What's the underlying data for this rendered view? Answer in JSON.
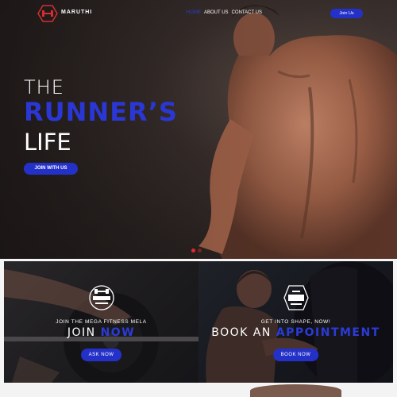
{
  "nav": {
    "brand": "MARUTHI",
    "items": [
      {
        "label": "HOME",
        "active": true
      },
      {
        "label": "ABOUT US",
        "active": false
      },
      {
        "label": "CONTACT US",
        "active": false
      }
    ],
    "join_label": "Join Us",
    "accent_color": "#2431c9",
    "logo_color": "#d32f2f"
  },
  "hero": {
    "line1": "THE",
    "line2": "RUNNER’S",
    "line3": "LIFE",
    "cta_label": "JOIN WITH US"
  },
  "promos": [
    {
      "badge_icon": "fitness-badge-icon",
      "subtitle": "JOIN THE MEGA FITNESS MELA",
      "head_plain": "JOIN",
      "head_accent": "NOW",
      "button_label": "ASK NOW"
    },
    {
      "badge_icon": "weight-badge-icon",
      "subtitle": "GET INTO SHAPE, NOW!",
      "head_plain": "BOOK AN",
      "head_accent": "APPOINTMENT",
      "button_label": "BOOK NOW"
    }
  ]
}
